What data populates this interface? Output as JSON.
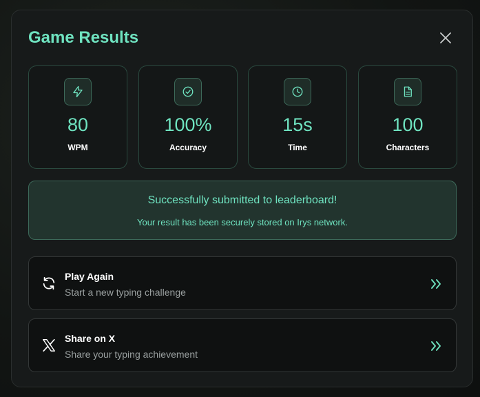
{
  "modal": {
    "title": "Game Results"
  },
  "stats": [
    {
      "value": "80",
      "label": "WPM",
      "icon": "lightning-icon"
    },
    {
      "value": "100%",
      "label": "Accuracy",
      "icon": "check-circle-icon"
    },
    {
      "value": "15s",
      "label": "Time",
      "icon": "clock-icon"
    },
    {
      "value": "100",
      "label": "Characters",
      "icon": "document-icon"
    }
  ],
  "success": {
    "message": "Successfully submitted to leaderboard!",
    "detail": "Your result has been securely stored on Irys network."
  },
  "actions": [
    {
      "title": "Play Again",
      "description": "Start a new typing challenge",
      "icon": "refresh-icon"
    },
    {
      "title": "Share on X",
      "description": "Share your typing achievement",
      "icon": "x-logo-icon"
    }
  ],
  "colors": {
    "accent": "#6fe3c0",
    "background": "#171a1a",
    "success_bg": "#22342e"
  }
}
